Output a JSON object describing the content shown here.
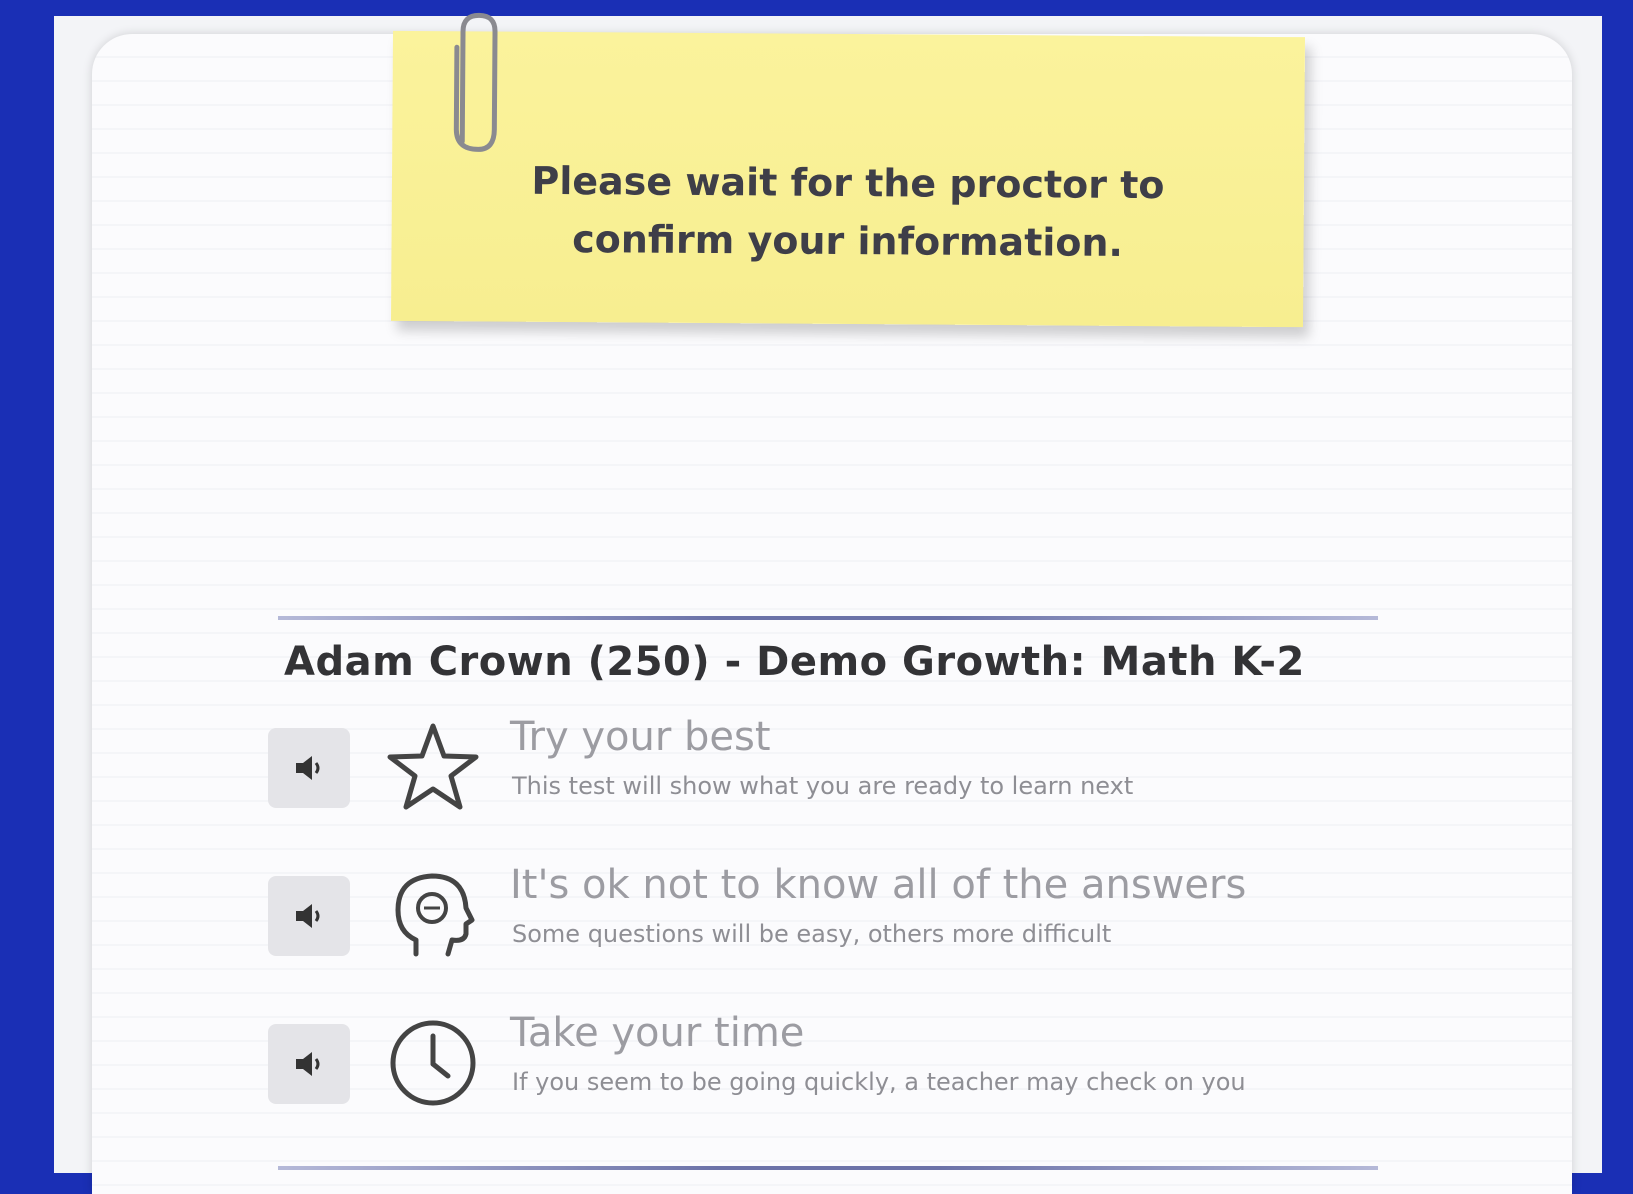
{
  "sticky_note": {
    "message_line1": "Please wait for the proctor to",
    "message_line2": "confirm your information."
  },
  "student_title": "Adam Crown (250) - Demo Growth: Math K-2",
  "tips": [
    {
      "icon": "star-icon",
      "heading": "Try your best",
      "subtext": "This test will show what you are ready to learn next"
    },
    {
      "icon": "thinking-head-icon",
      "heading": "It's ok not to know all of the answers",
      "subtext": "Some questions will be easy, others more difficult"
    },
    {
      "icon": "clock-icon",
      "heading": "Take your time",
      "subtext": "If you seem to be going quickly, a teacher may check on you"
    }
  ],
  "colors": {
    "background": "#1a2fb5",
    "sticky_note": "#f8ef94",
    "title_text": "#333336",
    "tip_text": "#9c9ca2"
  }
}
